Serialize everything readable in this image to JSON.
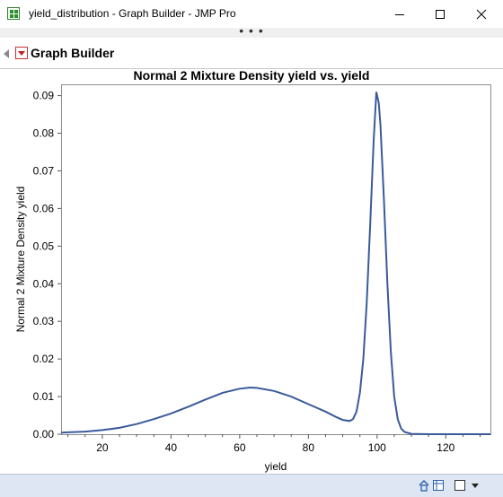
{
  "window": {
    "title": "yield_distribution - Graph Builder - JMP Pro",
    "minimize_glyph": "—",
    "maximize_glyph": "☐",
    "close_glyph": "✕",
    "icon": "jmp-data-table-icon"
  },
  "toolbar": {
    "ellipsis": "• • •"
  },
  "outline": {
    "title": "Graph Builder",
    "menu_icon": "red-triangle-menu-icon",
    "collapse_icon": "disclosure-triangle-icon"
  },
  "chart_data": {
    "type": "line",
    "title": "Normal 2 Mixture Density yield vs. yield",
    "xlabel": "yield",
    "ylabel": "Normal 2 Mixture Density yield",
    "xlim": [
      8,
      133
    ],
    "ylim": [
      0,
      0.093
    ],
    "xticks": [
      20,
      40,
      60,
      80,
      100,
      120
    ],
    "xtick_labels": [
      "20",
      "40",
      "60",
      "80",
      "100",
      "120"
    ],
    "yticks": [
      0,
      0.01,
      0.02,
      0.03,
      0.04,
      0.05,
      0.06,
      0.07,
      0.08,
      0.09
    ],
    "ytick_labels": [
      "0.00",
      "0.01",
      "0.02",
      "0.03",
      "0.04",
      "0.05",
      "0.06",
      "0.07",
      "0.08",
      "0.09"
    ],
    "grid": false,
    "line_color": "#3b5a9a",
    "series": [
      {
        "x": [
          8,
          10,
          15,
          20,
          25,
          30,
          35,
          40,
          45,
          50,
          55,
          60,
          63,
          65,
          70,
          75,
          80,
          85,
          88,
          90,
          92,
          93,
          94,
          95,
          96,
          97,
          98,
          99,
          99.8,
          100.5,
          101,
          102,
          103,
          104,
          105,
          106,
          107,
          108,
          110,
          115,
          120,
          125,
          130,
          133
        ],
        "values": [
          0.0004,
          0.0005,
          0.0007,
          0.0011,
          0.0017,
          0.0027,
          0.004,
          0.0055,
          0.0073,
          0.0092,
          0.011,
          0.0121,
          0.0124,
          0.0123,
          0.0115,
          0.01,
          0.008,
          0.006,
          0.0046,
          0.0038,
          0.0035,
          0.004,
          0.006,
          0.011,
          0.02,
          0.035,
          0.056,
          0.078,
          0.091,
          0.088,
          0.082,
          0.062,
          0.04,
          0.022,
          0.01,
          0.004,
          0.0015,
          0.0006,
          0.0001,
          0.0,
          0.0,
          0.0,
          0.0,
          0.0
        ]
      }
    ]
  },
  "statusbar": {
    "home_icon": "home-icon",
    "table_icon": "data-table-icon",
    "select_icon": "layout-select-icon",
    "dropdown_icon": "dropdown-arrow-icon"
  }
}
